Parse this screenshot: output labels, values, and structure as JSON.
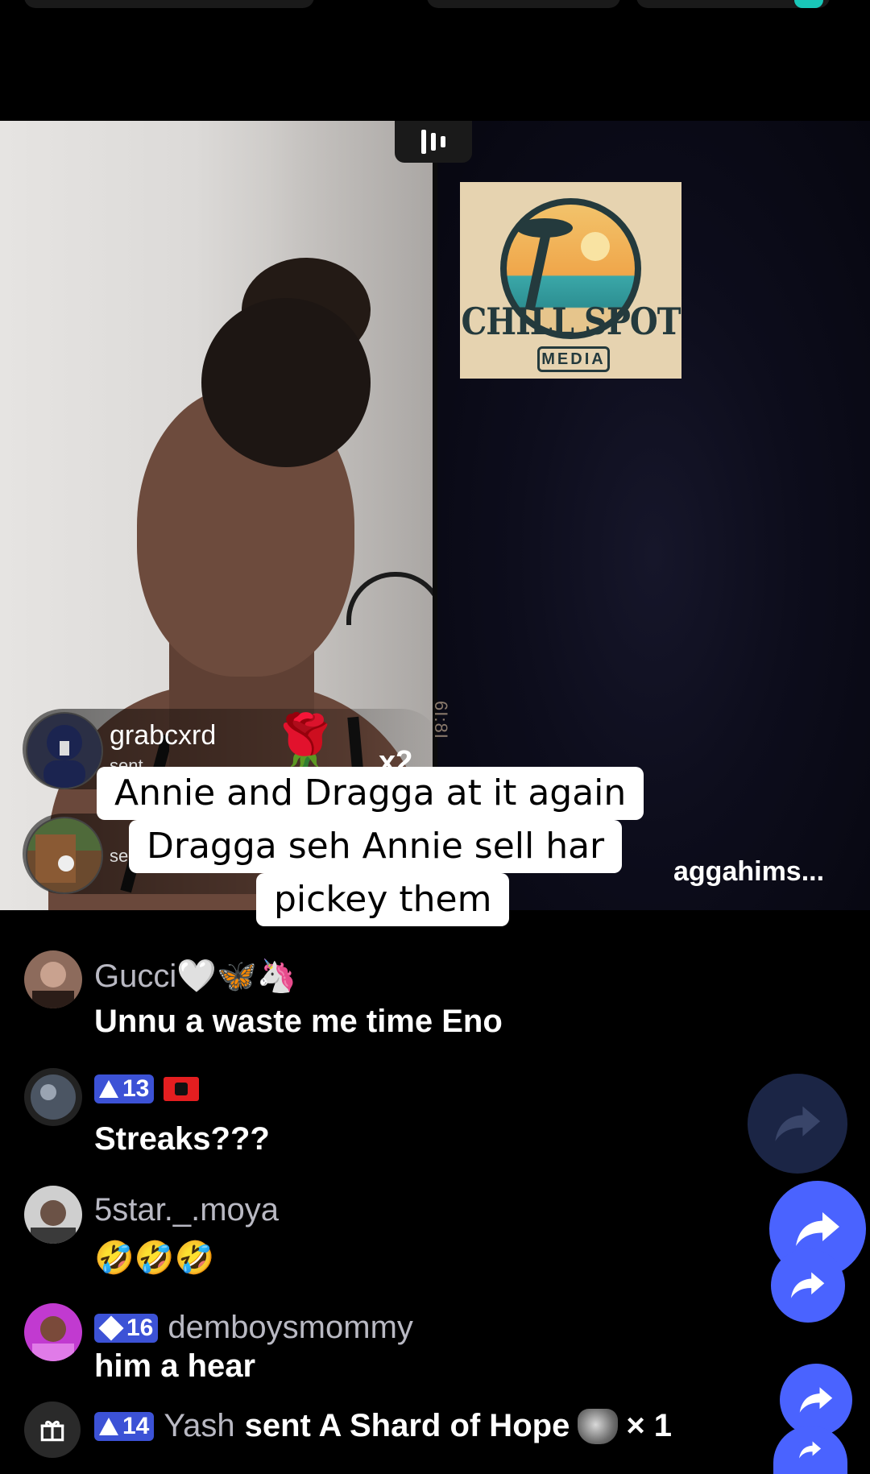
{
  "stream": {
    "left_gift": {
      "username": "grabcxrd",
      "sent_text": "sent Rose",
      "gift_icon": "rose-icon",
      "multiplier": "x2"
    },
    "second_gift": {
      "sent_text": "se"
    },
    "right_partial_label": "aggahims...",
    "vertical_text": "6I:8I",
    "logo": {
      "title": "CHILL SPOT",
      "subtitle": "MEDIA"
    }
  },
  "caption": {
    "line1": "Annie and Dragga at it again",
    "line2": "Dragga seh Annie sell har",
    "line3": "pickey them"
  },
  "chat": {
    "messages": [
      {
        "name": "Gucci🤍🦋🦄",
        "text": "Unnu a waste me time Eno"
      },
      {
        "badge": "13",
        "name": "",
        "text": "Streaks???"
      },
      {
        "name": "5star._.moya",
        "text": "🤣🤣🤣"
      },
      {
        "badge": "16",
        "name": "demboysmommy",
        "text": "him a hear"
      }
    ],
    "gift_message": {
      "badge": "14",
      "name": "Yash",
      "text_before": "sent A Shard of Hope",
      "count": "× 1"
    }
  },
  "colors": {
    "badge_blue": "#3c52d6",
    "share_blue": "#4a63ff",
    "chat_name_gray": "#b9b9c3"
  }
}
